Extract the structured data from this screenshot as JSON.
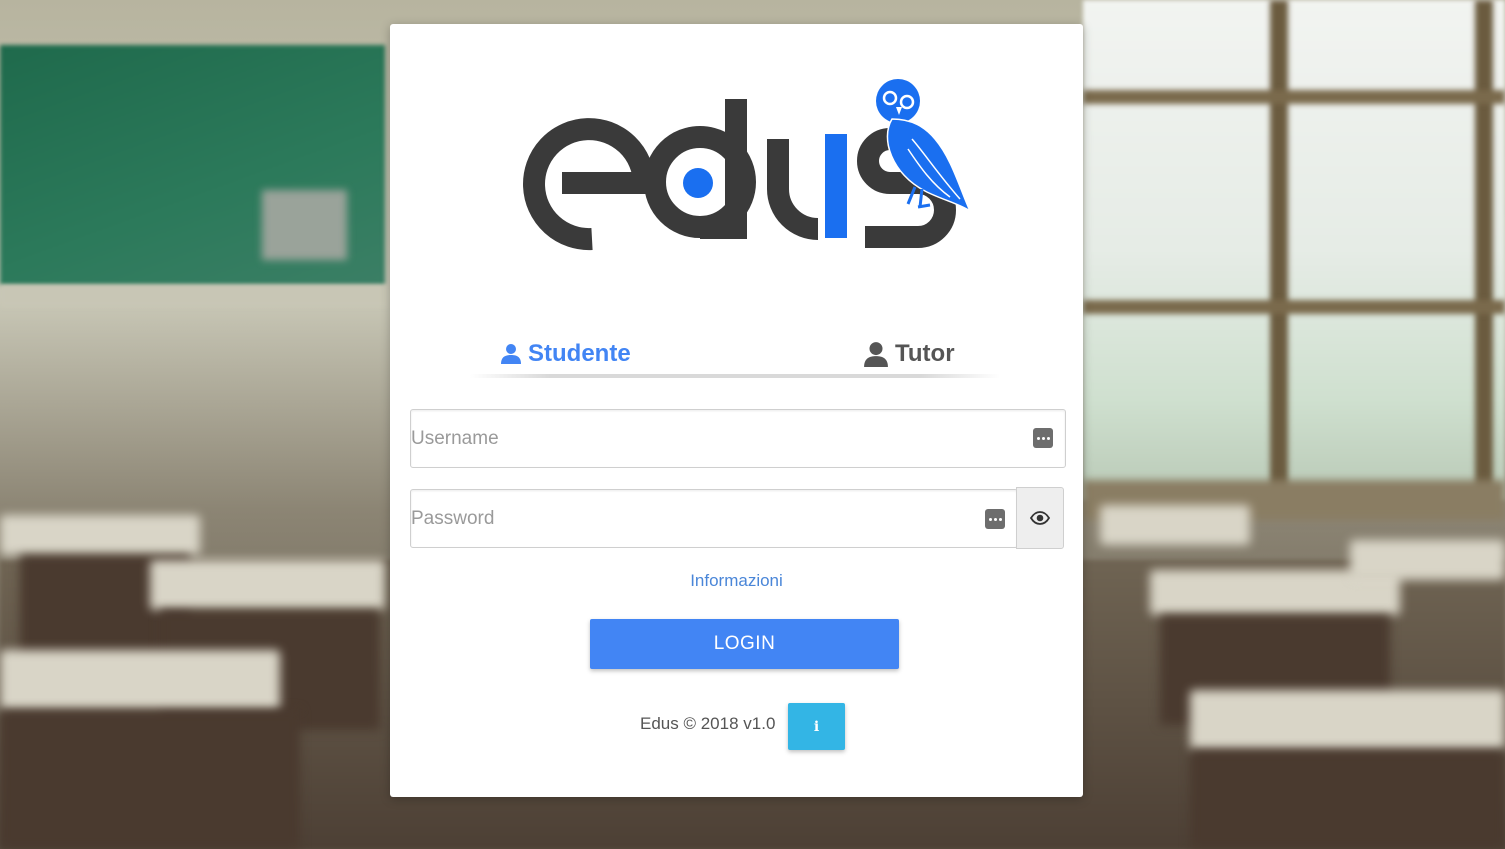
{
  "logo": {
    "text": "edus",
    "brand_dark": "#3a3a3a",
    "brand_accent": "#1a6ff0"
  },
  "tabs": [
    {
      "label": "Studente",
      "icon": "user-icon",
      "active": true
    },
    {
      "label": "Tutor",
      "icon": "user-icon",
      "active": false
    }
  ],
  "form": {
    "username": {
      "placeholder": "Username",
      "value": "",
      "icon": "dots-icon"
    },
    "password": {
      "placeholder": "Password",
      "value": "",
      "icon": "dots-icon",
      "toggle_icon": "eye-icon"
    }
  },
  "info_link": "Informazioni",
  "login_label": "LOGIN",
  "footer": {
    "text": "Edus © 2018 v1.0",
    "info_icon": "info-icon"
  },
  "colors": {
    "primary": "#4285f4",
    "info": "#33b5e5",
    "card": "#ffffff"
  }
}
